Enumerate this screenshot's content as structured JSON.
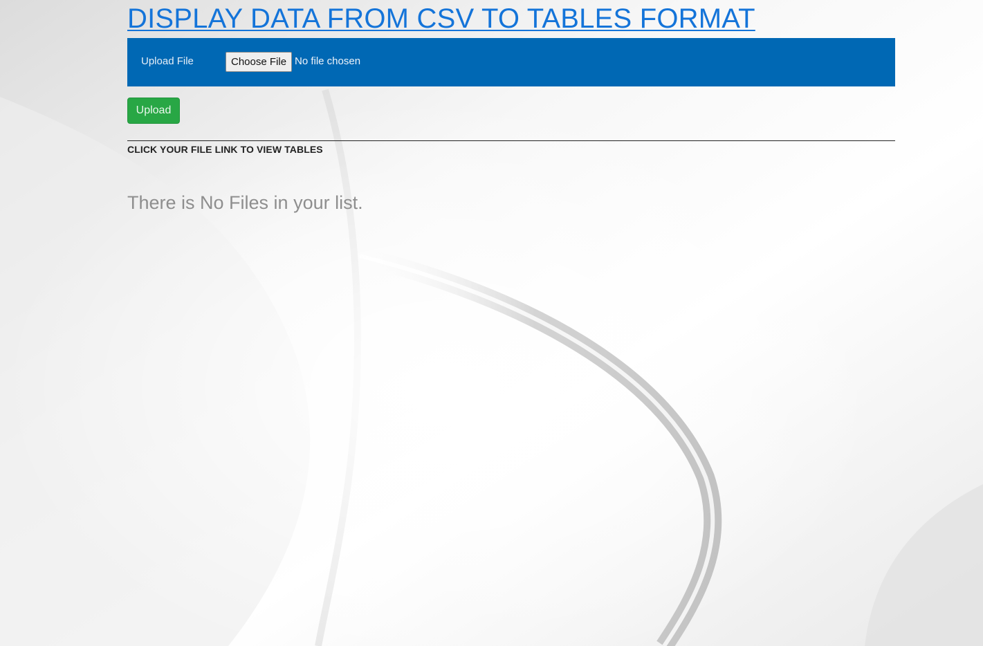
{
  "header": {
    "title": "DISPLAY DATA FROM CSV TO TABLES FORMAT"
  },
  "upload_form": {
    "label": "Upload File",
    "choose_button": "Choose File",
    "file_status": "No file chosen",
    "submit_button": "Upload"
  },
  "files_section": {
    "heading": "CLICK YOUR FILE LINK TO VIEW TABLES",
    "empty_message": "There is No Files in your list."
  },
  "colors": {
    "title": "#1474d9",
    "upload_bar": "#0068b4",
    "upload_button": "#28a745",
    "empty_message": "#8e8e8e"
  }
}
